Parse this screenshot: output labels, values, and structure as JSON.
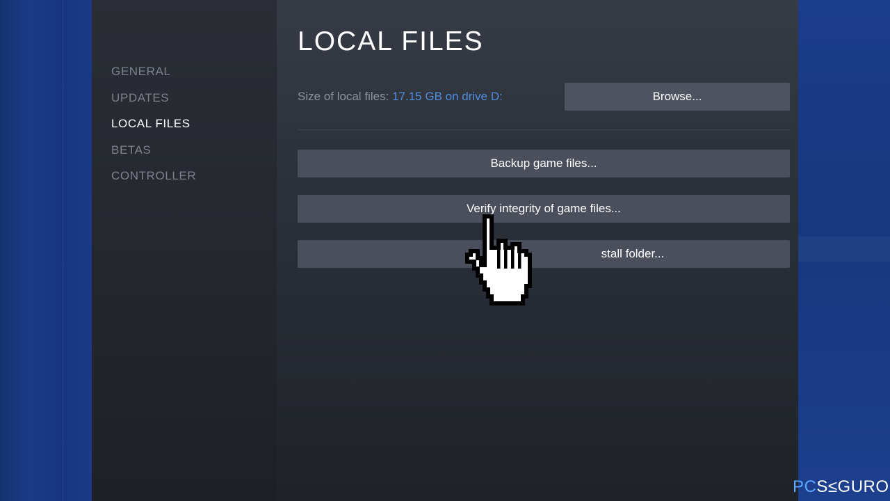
{
  "sidebar": {
    "items": [
      {
        "label": "GENERAL",
        "active": false
      },
      {
        "label": "UPDATES",
        "active": false
      },
      {
        "label": "LOCAL FILES",
        "active": true
      },
      {
        "label": "BETAS",
        "active": false
      },
      {
        "label": "CONTROLLER",
        "active": false
      }
    ]
  },
  "main": {
    "title": "LOCAL FILES",
    "size_label": "Size of local files:",
    "size_value": "17.15 GB on drive D:",
    "browse_label": "Browse...",
    "backup_label": "Backup game files...",
    "verify_label": "Verify integrity of game files...",
    "install_folder_label": "stall folder..."
  },
  "cursor": {
    "icon": "hand-pointer-icon"
  },
  "watermark": {
    "prefix": "PC",
    "suffix": "S≤GURO"
  },
  "colors": {
    "accent_link": "#4f8fe0",
    "button": "#4a4f5b",
    "sidebar_active": "#ffffff",
    "sidebar_inactive": "#7d828c"
  }
}
